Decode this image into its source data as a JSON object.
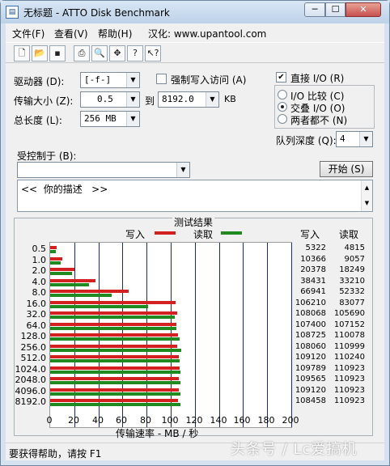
{
  "window": {
    "title": "无标题 - ATTO Disk Benchmark",
    "close": "✕",
    "minimize": "─",
    "maximize": "☐"
  },
  "menu": [
    "文件(F)",
    "查看(V)",
    "帮助(H)",
    "汉化: www.upantool.com"
  ],
  "toolbar_icons": [
    "new-file-icon",
    "open-folder-icon",
    "save-disk-icon",
    "print-icon",
    "print-preview-icon",
    "move-icon",
    "help-question-icon",
    "context-help-icon"
  ],
  "settings": {
    "drive_label": "驱动器 (D):",
    "drive_value": "[-f-]",
    "transfer_label": "传输大小 (Z):",
    "transfer_from": "0.5",
    "to_label": "到",
    "transfer_to": "8192.0",
    "kb_label": "KB",
    "total_label": "总长度 (L):",
    "total_value": "256 MB",
    "force_write_label": "强制写入访问 (A)",
    "force_write_checked": false,
    "direct_io_label": "直接 I/O (R)",
    "direct_io_checked": true,
    "io_compare_label": "I/O 比较 (C)",
    "overlapped_io_label": "交叠 I/O (O)",
    "neither_label": "两者都不 (N)",
    "selected_io": "overlapped",
    "queue_label": "队列深度 (Q):",
    "queue_value": "4",
    "controlled_label": "受控制于 (B):",
    "controlled_value": "",
    "start_button": "开始 (S)",
    "description": "<<  你的描述   >>"
  },
  "results": {
    "title": "测试结果",
    "legend_write": "写入",
    "legend_read": "读取",
    "col_write": "写入",
    "col_read": "读取",
    "x_axis_label": "传输速率 - MB / 秒"
  },
  "chart_data": {
    "type": "bar",
    "orientation": "horizontal",
    "categories": [
      "0.5",
      "1.0",
      "2.0",
      "4.0",
      "8.0",
      "16.0",
      "32.0",
      "64.0",
      "128.0",
      "256.0",
      "512.0",
      "1024.0",
      "2048.0",
      "4096.0",
      "8192.0"
    ],
    "series": [
      {
        "name": "写入",
        "color": "#d32020",
        "values": [
          5322,
          10366,
          20378,
          38431,
          66941,
          106210,
          108068,
          107400,
          108725,
          108060,
          109120,
          109789,
          109565,
          109120,
          108458
        ]
      },
      {
        "name": "读取",
        "color": "#1f8a1f",
        "values": [
          4815,
          9057,
          18249,
          33210,
          52332,
          83077,
          105690,
          107152,
          110078,
          110999,
          110240,
          110923,
          110923,
          110923,
          110923
        ]
      }
    ],
    "units": "KB/s",
    "xlabel": "传输速率 - MB / 秒",
    "xticks": [
      "0",
      "20",
      "40",
      "60",
      "80",
      "100",
      "120",
      "140",
      "160",
      "180",
      "200"
    ],
    "xlim": [
      0,
      200
    ]
  },
  "status": "要获得帮助，请按 F1",
  "watermark": "头条号 / Lc爱搞机"
}
